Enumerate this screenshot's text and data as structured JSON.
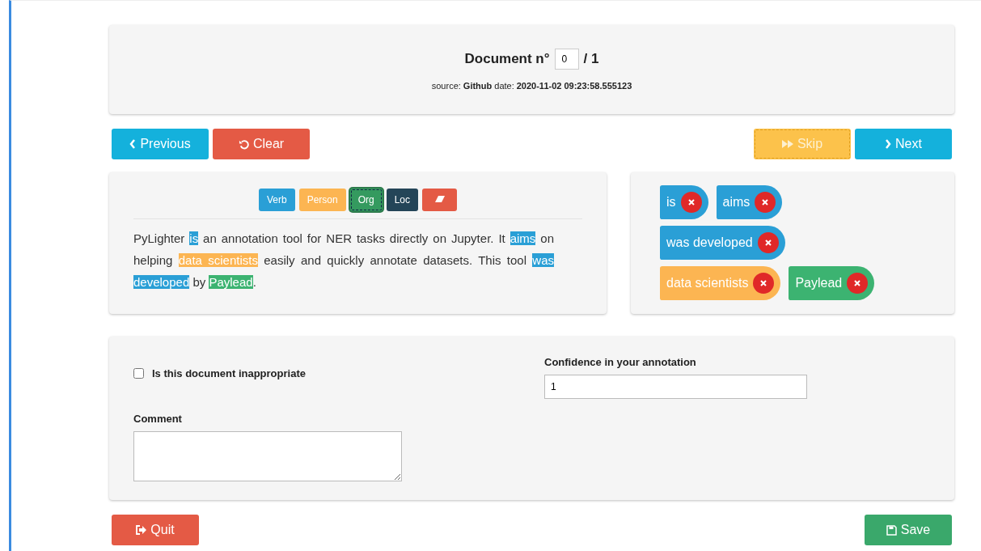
{
  "header": {
    "title": "Document n°",
    "doc_index": "0",
    "total": "/ 1",
    "source_label": "source:",
    "source": "Github",
    "date_label": "date:",
    "date": "2020-11-02 09:23:58.555123"
  },
  "nav": {
    "previous": "Previous",
    "clear": "Clear",
    "skip": "Skip",
    "next": "Next"
  },
  "labels": [
    {
      "text": "Verb",
      "color": "#2a9fd6",
      "selected": false
    },
    {
      "text": "Person",
      "color": "#fcb552",
      "selected": false
    },
    {
      "text": "Org",
      "color": "#349a5f",
      "selected": true
    },
    {
      "text": "Loc",
      "color": "#244558",
      "selected": false
    }
  ],
  "eraser": true,
  "segments": [
    {
      "text": "PyLighter "
    },
    {
      "text": "is",
      "color": "#2a9fd6"
    },
    {
      "text": " an annotation tool for NER tasks directly on Jupyter. It "
    },
    {
      "text": "aims",
      "color": "#2a9fd6"
    },
    {
      "text": " on helping "
    },
    {
      "text": "data scientists",
      "color": "#fcb552"
    },
    {
      "text": " easily and quickly annotate datasets. This tool "
    },
    {
      "text": "was developed",
      "color": "#2a9fd6"
    },
    {
      "text": " by "
    },
    {
      "text": "Paylead",
      "color": "#3cb371"
    },
    {
      "text": "."
    }
  ],
  "annotations": [
    {
      "text": "is",
      "color": "#2a9fd6"
    },
    {
      "text": "aims",
      "color": "#2a9fd6"
    },
    {
      "text": "was developed",
      "color": "#2a9fd6"
    },
    {
      "text": "data scientists",
      "color": "#fcb552"
    },
    {
      "text": "Paylead",
      "color": "#3cb371"
    }
  ],
  "form": {
    "inappropriate": {
      "label": "Is this document inappropriate",
      "checked": false
    },
    "confidence": {
      "label": "Confidence in your annotation",
      "value": "1"
    },
    "comment": {
      "label": "Comment"
    }
  },
  "footer": {
    "quit": "Quit",
    "save": "Save"
  }
}
